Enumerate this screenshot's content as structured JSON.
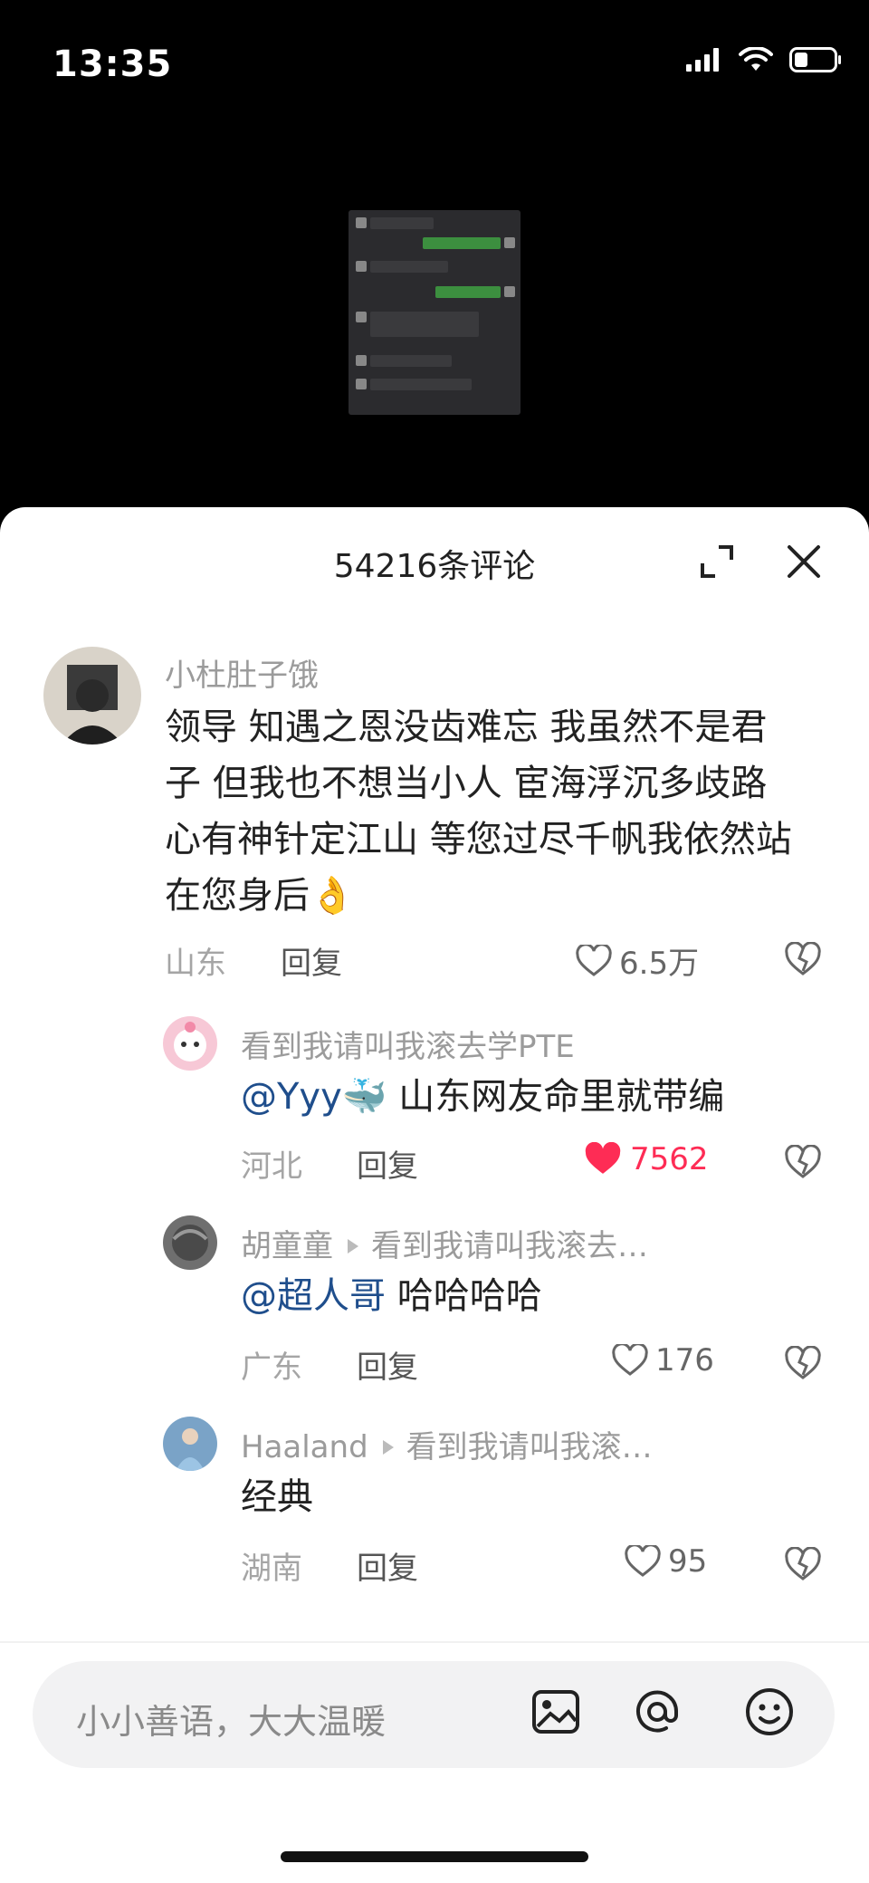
{
  "status": {
    "time": "13:35"
  },
  "header": {
    "title": "54216条评论"
  },
  "comments": [
    {
      "user": "小杜肚子饿",
      "text": "领导 知遇之恩没齿难忘 我虽然不是君子 但我也不想当小人 宦海浮沉多歧路 心有神针定江山 等您过尽千帆我依然站在您身后",
      "emoji": "👌",
      "location": "山东",
      "reply_label": "回复",
      "likes": "6.5万"
    },
    {
      "user": "看到我请叫我滚去学PTE",
      "mention": "@Yyy",
      "emoji": "🐳",
      "text": " 山东网友命里就带编",
      "location": "河北",
      "reply_label": "回复",
      "likes": "7562",
      "liked": true
    },
    {
      "user": "胡童童",
      "reply_to": "看到我请叫我滚去…",
      "mention": "@超人哥",
      "text": " 哈哈哈哈",
      "location": "广东",
      "reply_label": "回复",
      "likes": "176"
    },
    {
      "user": "Haaland",
      "reply_to": "看到我请叫我滚…",
      "text": "经典",
      "location": "湖南",
      "reply_label": "回复",
      "likes": "95"
    }
  ],
  "input": {
    "placeholder": "小小善语，大大温暖"
  },
  "colors": {
    "accent": "#fe2c55",
    "mention": "#1f4e8c",
    "background": "#ffffff"
  },
  "icons": [
    "signal-icon",
    "wifi-icon",
    "battery-icon",
    "expand-icon",
    "close-icon",
    "heart-icon",
    "dislike-icon",
    "image-icon",
    "at-icon",
    "emoji-icon"
  ]
}
